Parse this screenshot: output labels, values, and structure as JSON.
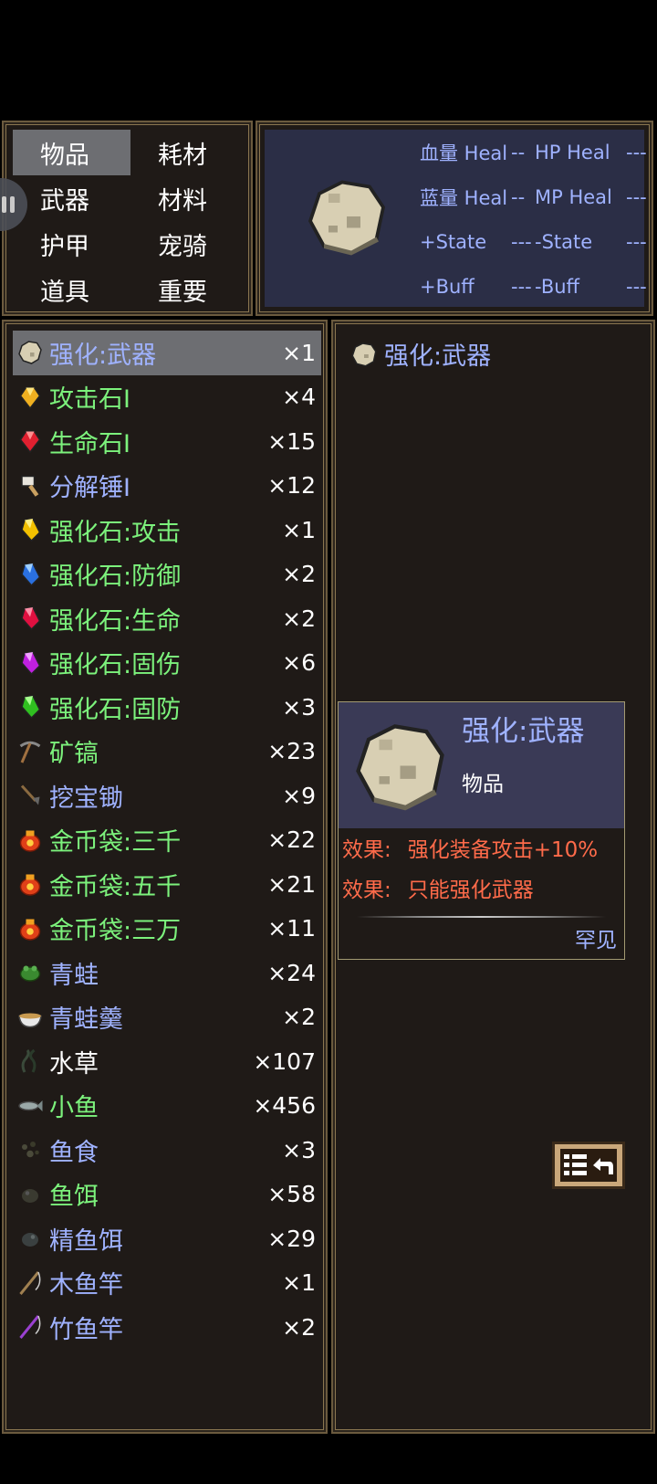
{
  "categories": [
    "物品",
    "耗材",
    "武器",
    "材料",
    "护甲",
    "宠骑",
    "道具",
    "重要"
  ],
  "stats": [
    {
      "a": "血量 Heal",
      "b": "--",
      "c": "HP Heal",
      "d": "---"
    },
    {
      "a": "蓝量 Heal",
      "b": "--",
      "c": "MP Heal",
      "d": "---"
    },
    {
      "a": "+State",
      "b": "---",
      "c": "-State",
      "d": "---"
    },
    {
      "a": "+Buff",
      "b": "---",
      "c": "-Buff",
      "d": "---"
    }
  ],
  "items": [
    {
      "name": "强化:武器",
      "count": "×1",
      "color": "blue",
      "icon": "stone-icon"
    },
    {
      "name": "攻击石I",
      "count": "×4",
      "color": "green",
      "icon": "gold-gem-icon"
    },
    {
      "name": "生命石I",
      "count": "×15",
      "color": "green",
      "icon": "red-gem-icon"
    },
    {
      "name": "分解锤I",
      "count": "×12",
      "color": "blue",
      "icon": "hammer-icon"
    },
    {
      "name": "强化石:攻击",
      "count": "×1",
      "color": "green",
      "icon": "yellow-crystal-icon"
    },
    {
      "name": "强化石:防御",
      "count": "×2",
      "color": "green",
      "icon": "blue-crystal-icon"
    },
    {
      "name": "强化石:生命",
      "count": "×2",
      "color": "green",
      "icon": "red-crystal-icon"
    },
    {
      "name": "强化石:固伤",
      "count": "×6",
      "color": "green",
      "icon": "purple-crystal-icon"
    },
    {
      "name": "强化石:固防",
      "count": "×3",
      "color": "green",
      "icon": "green-crystal-icon"
    },
    {
      "name": "矿镐",
      "count": "×23",
      "color": "green",
      "icon": "pickaxe-icon"
    },
    {
      "name": "挖宝锄",
      "count": "×9",
      "color": "blue",
      "icon": "hoe-icon"
    },
    {
      "name": "金币袋:三千",
      "count": "×22",
      "color": "green",
      "icon": "coin-bag-icon"
    },
    {
      "name": "金币袋:五千",
      "count": "×21",
      "color": "green",
      "icon": "coin-bag-icon"
    },
    {
      "name": "金币袋:三万",
      "count": "×11",
      "color": "green",
      "icon": "coin-bag-icon"
    },
    {
      "name": "青蛙",
      "count": "×24",
      "color": "blue",
      "icon": "frog-icon"
    },
    {
      "name": "青蛙羹",
      "count": "×2",
      "color": "blue",
      "icon": "soup-bowl-icon"
    },
    {
      "name": "水草",
      "count": "×107",
      "color": "white",
      "icon": "seaweed-icon"
    },
    {
      "name": "小鱼",
      "count": "×456",
      "color": "green",
      "icon": "fish-icon"
    },
    {
      "name": "鱼食",
      "count": "×3",
      "color": "blue",
      "icon": "fish-food-icon"
    },
    {
      "name": "鱼饵",
      "count": "×58",
      "color": "green",
      "icon": "bait-icon"
    },
    {
      "name": "精鱼饵",
      "count": "×29",
      "color": "blue",
      "icon": "fine-bait-icon"
    },
    {
      "name": "木鱼竿",
      "count": "×1",
      "color": "blue",
      "icon": "wood-rod-icon"
    },
    {
      "name": "竹鱼竿",
      "count": "×2",
      "color": "blue",
      "icon": "bamboo-rod-icon"
    }
  ],
  "detail": {
    "title": "强化:武器",
    "tooltip": {
      "name": "强化:武器",
      "type": "物品",
      "effect_label": "效果:",
      "effect1": "强化装备攻击+10%",
      "effect2": "只能强化武器",
      "rarity": "罕见"
    }
  }
}
